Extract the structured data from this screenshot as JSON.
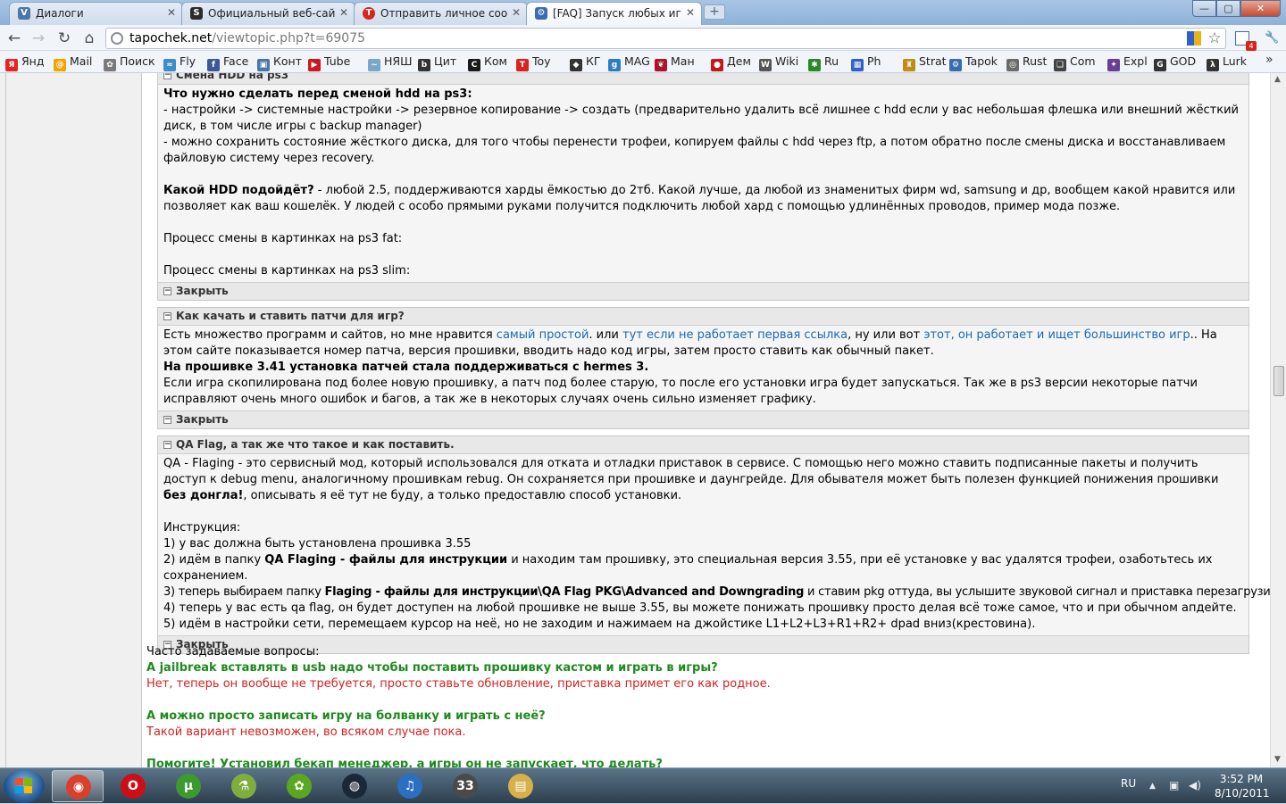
{
  "tabs": [
    {
      "title": "Диалоги",
      "favicon": "V",
      "color": "#4a76a8"
    },
    {
      "title": "Официальный веб-сайт PI",
      "favicon": "S",
      "color": "#2b2b2b"
    },
    {
      "title": "Отправить личное сообщ",
      "favicon": "T",
      "color": "#d8241c"
    },
    {
      "title": "[FAQ] Запуск любых игр и",
      "favicon": "⚙",
      "color": "#3b6cb0"
    }
  ],
  "tab_close_glyph": "✕",
  "new_tab_glyph": "+",
  "window_controls": {
    "minimize": "—",
    "maximize": "▢",
    "close": "✕"
  },
  "toolbar": {
    "back": "←",
    "forward": "→",
    "reload": "↻",
    "home": "⌂",
    "url_host": "tapochek.net",
    "url_path": "/viewtopic.php?t=69075",
    "star": "☆",
    "wrench": "🔧",
    "mail_badge": "4"
  },
  "bookmarks": [
    {
      "label": "Янд",
      "icon": "Я",
      "color": "#e52620"
    },
    {
      "label": "Mail",
      "icon": "@",
      "color": "#f5a300"
    },
    {
      "label": "Поиск",
      "icon": "✿",
      "color": "#7a7a7a"
    },
    {
      "label": "Fly",
      "icon": "≈",
      "color": "#3b8ec9"
    },
    {
      "label": "Face",
      "icon": "f",
      "color": "#3b5998"
    },
    {
      "label": "Конт",
      "icon": "▣",
      "color": "#4a76a8"
    },
    {
      "label": "Tube",
      "icon": "▶",
      "color": "#cc181e"
    },
    {
      "label": "НЯШ",
      "icon": "~",
      "color": "#7aa7c7"
    },
    {
      "label": "Цит",
      "icon": "b",
      "color": "#333333"
    },
    {
      "label": "Ком",
      "icon": "C",
      "color": "#1a1a1a"
    },
    {
      "label": "Toy",
      "icon": "T",
      "color": "#d8241c"
    },
    {
      "label": "КГ",
      "icon": "◆",
      "color": "#333333"
    },
    {
      "label": "MAG",
      "icon": "g",
      "color": "#2a7fc4"
    },
    {
      "label": "Ман",
      "icon": "❦",
      "color": "#b0122b"
    },
    {
      "label": "Дем",
      "icon": "●",
      "color": "#c21a1a"
    },
    {
      "label": "Wiki",
      "icon": "W",
      "color": "#555555"
    },
    {
      "label": "Ru",
      "icon": "✱",
      "color": "#2a8a2a"
    },
    {
      "label": "Ph",
      "icon": "▦",
      "color": "#2f62c6"
    },
    {
      "label": "Strat",
      "icon": "♜",
      "color": "#c28a16"
    },
    {
      "label": "Tapok",
      "icon": "⚙",
      "color": "#3b6cb0"
    },
    {
      "label": "Rust",
      "icon": "◎",
      "color": "#6b6b6b"
    },
    {
      "label": "Com",
      "icon": "❏",
      "color": "#444444"
    },
    {
      "label": "Expl",
      "icon": "✦",
      "color": "#6a3d9a"
    },
    {
      "label": "GOD",
      "icon": "G",
      "color": "#333333"
    },
    {
      "label": "Lurk",
      "icon": "λ",
      "color": "#333333"
    }
  ],
  "bookmarks_more": "»",
  "post": {
    "spoiler1": {
      "title": "Смена HDD на ps3",
      "l1_bold": "Что нужно сделать перед сменой hdd на ps3:",
      "l2": "- настройки -> системные настройки -> резервное копирование -> создать (предварительно удалить всё лишнее с hdd если у вас небольшая флешка или внешний жёсткий диск, в том числе игры с backup manager)",
      "l3": "- можно сохранить состояние жёсткого диска, для того чтобы перенести трофеи, копируем файлы с hdd через ftp, а потом обратно после смены диска и восстанавливаем файловую систему через recovery.",
      "l4_bold": "Какой HDD подойдёт?",
      "l4": " - любой 2.5, поддерживаются харды ёмкостью до 2тб. Какой лучше, да любой из знаменитых фирм wd, samsung и др, вообщем какой нравится или позволяет как ваш кошелёк. У людей с особо прямыми руками получится подключить любой хард с помощью удлинённых проводов, пример мода позже.",
      "l5": "Процесс смены в картинках на ps3 fat:",
      "l6": "Процесс смены в картинках на ps3 slim:"
    },
    "close_label": "Закрыть",
    "toggle_glyph": "−",
    "spoiler2": {
      "title": "Как качать и ставить патчи для игр?",
      "l1a": "Есть множество программ и сайтов, но мне нравится ",
      "link1": "самый простой",
      "l1b": ". или ",
      "link2": "тут если не работает первая ссылка",
      "l1c": ", ну или вот ",
      "link3": "этот, он работает и ищет большинство игр",
      "l1d": ".. На этом сайте показывается номер патча, версия прошивки, вводить надо код игры, затем просто ставить как обычный пакет.",
      "l2_bold": "На прошивке 3.41 установка патчей стала поддерживаться с hermes 3.",
      "l3": "Если игра скопилирована под более новую прошивку, а патч под более старую, то после его установки игра будет запускаться. Так же в ps3 версии некоторые патчи исправляют очень много ошибок и багов, а так же в некоторых случаях очень сильно изменяет графику."
    },
    "spoiler3": {
      "title": "QA Flag, а так же что такое и как поставить.",
      "l1a": "QA - Flaging - это сервисный мод, который использовался для отката и отладки приставок в сервисе. С помощью него можно ставить подписанные пакеты и получить доступ к debug menu, аналогичному прошивкам rebug. Он сохраняется при прошивке и даунгрейде. Для обывателя может быть полезен функцией понижения прошивки ",
      "l1_bold": "без донгла!",
      "l1b": ", описывать я её тут не буду, а только предоставлю способ установки.",
      "instr": "Инструкция:",
      "s1": "1) у вас должна быть установлена прошивка 3.55",
      "s2a": "2) идём в папку ",
      "s2_bold": "QA Flaging - файлы для инструкции",
      "s2b": " и находим там прошивку, это специальная версия 3.55, при её установке у вас удалятся трофеи, озаботьтесь их сохранением.",
      "s3a": "3) теперь выбираем папку ",
      "s3_bold": "Flaging - файлы для инструкции\\QA Flag PKG\\Advanced and Downgrading",
      "s3b": " и ставим pkg оттуда, вы услышите звуковой сигнал и приставка перезагрузится",
      "s4": "4) теперь у вас есть qa flag, он будет доступен на любой прошивке не выше 3.55, вы можете понижать прошивку просто делая всё тоже самое, что и при обычном апдейте.",
      "s5": "5) идём в настройки сети, перемещаем курсор на неё, но не заходим и нажимаем на джойстике L1+L2+L3+R1+R2+ dpad вниз(крестовина)."
    },
    "faq": {
      "heading": "Часто задаваемые вопросы:",
      "q1": "А jailbreak вставлять в usb надо чтобы поставить прошивку кастом и играть в игры?",
      "a1": "Нет, теперь он вообще не требуется, просто ставьте обновление, приставка примет его как родное.",
      "q2": "А можно просто записать игру на болванку и играть с неё?",
      "a2": "Такой вариант невозможен, во всяком случае пока.",
      "q3": "Помогите! Установил бекап менеджер, а игры он не запускает, что делать?"
    }
  },
  "scrollbar": {
    "up": "▲",
    "down": "▼"
  },
  "taskbar": {
    "apps": [
      {
        "name": "chrome",
        "glyph": "◉",
        "color": "#d8402c"
      },
      {
        "name": "opera",
        "glyph": "O",
        "color": "#cc0f16"
      },
      {
        "name": "utorrent",
        "glyph": "µ",
        "color": "#3c9a2e"
      },
      {
        "name": "tools",
        "glyph": "⚗",
        "color": "#7fae3f"
      },
      {
        "name": "icq",
        "glyph": "✿",
        "color": "#5aa81f"
      },
      {
        "name": "steam",
        "glyph": "◍",
        "color": "#1b2838"
      },
      {
        "name": "itunes",
        "glyph": "♫",
        "color": "#2a6fc2"
      },
      {
        "name": "monitor",
        "glyph": "33",
        "color": "#4a4a4a"
      },
      {
        "name": "explorer",
        "glyph": "▤",
        "color": "#d8b04a"
      }
    ],
    "lang": "RU",
    "tray_up": "▲",
    "tray_net": "▣",
    "tray_sound": "◀)",
    "time": "3:52 PM",
    "date": "8/10/2011"
  }
}
